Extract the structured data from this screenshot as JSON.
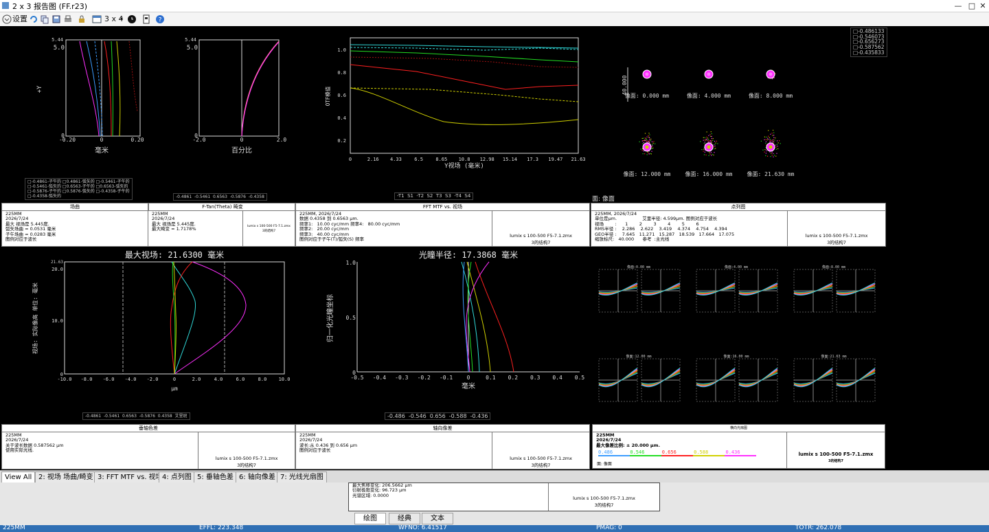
{
  "window": {
    "title": "2 x 3 报告图 (FF.r23)",
    "minimize": "—",
    "maximize": "□",
    "close": "✕"
  },
  "toolbar": {
    "settings": "设置",
    "layout": "3 x 4"
  },
  "top_legend": [
    "-0.486133",
    "-0.546073",
    "-0.656273",
    "-0.587562",
    "-0.435833"
  ],
  "plot1": {
    "ylabel": "+Y",
    "ymax_tick": "5.44",
    "y5": "5.0",
    "y0": "0",
    "xticks": [
      "-0.20",
      "0",
      "0.20"
    ],
    "xlabel": "毫米",
    "legend": [
      [
        "-0.4861-子午的",
        "0.4861-弧矢的",
        "-0.5461-子午的"
      ],
      [
        "-0.5461-弧矢的",
        "0.6563-子午的",
        "0.6563-弧矢的"
      ],
      [
        "-0.5876-子午的",
        "0.5876-弧矢的",
        "-0.4358-子午的"
      ],
      [
        "-0.4358-弧矢的",
        "",
        ""
      ]
    ]
  },
  "plot2": {
    "ymax_tick": "5.44",
    "y5": "5.0",
    "y0": "0",
    "xticks": [
      "-2.0",
      "0",
      "2.0"
    ],
    "xlabel": "百分比",
    "legend": "-0.4861  -0.5461  0.6563  -0.5876  -0.4358"
  },
  "mtf": {
    "ylabel": "OTF模值",
    "yticks": [
      "1.0",
      "0.8",
      "0.6",
      "0.4",
      "0.2"
    ],
    "xticks": [
      "0",
      "2.16",
      "4.33",
      "6.5",
      "8.65",
      "10.8",
      "12.98",
      "15.14",
      "17.3",
      "19.47",
      "21.63"
    ],
    "xlabel": "Y视场 (毫米)",
    "legend": "-T1  S1  -T2  S2  T3  S3  -T4  S4"
  },
  "spot": {
    "scale_label": "40.000",
    "labels": [
      "像面: 0.000 mm",
      "像面: 4.000 mm",
      "像面: 8.000 mm",
      "像面: 12.000 mm",
      "像面: 16.000 mm",
      "像面: 21.630 mm"
    ],
    "surface_label": "面: 像面"
  },
  "info_fc": {
    "h1": "场曲",
    "h2": "F-Tan(Theta) 畸变",
    "t1": "225MM\n2026/7/24\n最大 视场是 5.445度.\n弧矢场曲 = 0.0531 毫米\n子午场曲 = 0.0283 毫米\n图例对应于波长",
    "t2": "225MM\n2026/7/24\n最大 视场是 5.445度.\n最大畸变 = 1.7178%",
    "r": "lumix s 100-500 F5-7.1.zmx",
    "r2": "3的结构7"
  },
  "info_mtf": {
    "h": "FFT MTF vs. 视场",
    "t": "225MM, 2026/7/24\n数据 0.4358 到 0.6563 μm.\n频率1:   10.00 cyc/mm 频率4:   80.00 cyc/mm\n频率2:   20.00 cyc/mm\n频率3:   40.00 cyc/mm\n图例对应于子午(T)/弧矢(S) 频率",
    "r": "lumix s 100-500 F5-7.1.zmx",
    "r2": "3的结构7"
  },
  "info_spot": {
    "h": "点列图",
    "t": "225MM, 2026/7/24\n单位是μm.                  艾里半径: 4.599μm. 图例对应于波长\n视场        :      1        2        3        4        5        6\nRMS半径 :    2.286    2.622    3.419    4.374    4.754    4.394\nGEO半径 :    7.645   11.271   15.287   18.539   17.664   17.075\n缩放标尺:   40.000      参考  :主光线",
    "r": "lumix s 100-500 F5-7.1.zmx",
    "r2": "3的结构7"
  },
  "lat": {
    "title": "最大视场: 21.6300 毫米",
    "ylabel": "视场: 实际像高 单位: 毫米",
    "ytop": "21.63",
    "yticks": [
      "20.0",
      "10.0",
      "0"
    ],
    "xticks": [
      "-10.0",
      "-8.0",
      "-6.0",
      "-4.0",
      "-2.0",
      "0",
      "2.0",
      "4.0",
      "6.0",
      "8.0",
      "10.0"
    ],
    "xlabel": "μm",
    "legend": "-0.4861  -0.5461  0.6563  -0.5876  0.4358  艾里斑"
  },
  "axial": {
    "title": "光瞳半径: 17.3868 毫米",
    "ylabel": "归一化光瞳坐标",
    "yticks": [
      "1.0",
      "0.5",
      "0"
    ],
    "xticks": [
      "-0.5",
      "-0.4",
      "-0.3",
      "-0.2",
      "-0.1",
      "0",
      "0.1",
      "0.2",
      "0.3",
      "0.4",
      "0.5"
    ],
    "xlabel": "毫米",
    "legend": "-0.486  -0.546  0.656  -0.588  -0.436"
  },
  "info_lat": {
    "h": "垂轴色差",
    "t": "225MM\n2026/7/24\n关于波长数据 0.587562 μm\n使用实际光线.",
    "r": "lumix s 100-500 F5-7.1.zmx",
    "r2": "3的结构7"
  },
  "info_axial": {
    "h": "轴向像差",
    "t": "225MM\n2026/7/24\n波长:从 0.436 到 0.656 μm\n图例对应于波长",
    "r": "lumix s 100-500 F5-7.1.zmx",
    "r2": "3的结构7"
  },
  "ray": {
    "labels": [
      "像面:0.00 mm",
      "像面:4.00 mm",
      "像面:8.00 mm",
      "像面:12.00 mm",
      "像面:16.00 mm",
      "像面:21.63 mm"
    ]
  },
  "info_ray": {
    "h": "横向光扇图",
    "t": "225MM\n2026/7/24\n最大像差比例: ± 20.000 μm.",
    "wl": [
      "0.486",
      "0.546",
      "0.656",
      "0.588",
      "0.436"
    ],
    "surf": "面: 像面",
    "r": "lumix s 100-500 F5-7.1.zmx",
    "r2": "3的结构7"
  },
  "tabs": [
    "View All",
    "2: 视场 场曲/畸变",
    "3: FFT MTF vs. 视场",
    "4: 点列图",
    "5: 垂轴色差",
    "6: 轴向像差",
    "7: 光线光扇图"
  ],
  "lower": {
    "t": "最大焦移变化: 206.5662 μm\n衍射极限变化: 96.723 μm\n光谱区域: 0.0000",
    "r": "lumix s 100-500 F5-7.1.zmx",
    "r2": "3的结构7",
    "tabs": [
      "绘图",
      "经典",
      "文本"
    ]
  },
  "status": {
    "name": "225MM",
    "effl": "EFFL: 223.348",
    "wfno": "WFNO: 6.41517",
    "pmag": "PMAG: 0",
    "totr": "TOTR: 262.078"
  },
  "colors": {
    "blue": "#3c9cff",
    "green": "#22dd22",
    "red": "#ff2020",
    "yellow": "#d0d000",
    "magenta": "#ff30ff",
    "cyan": "#30d8d8"
  }
}
